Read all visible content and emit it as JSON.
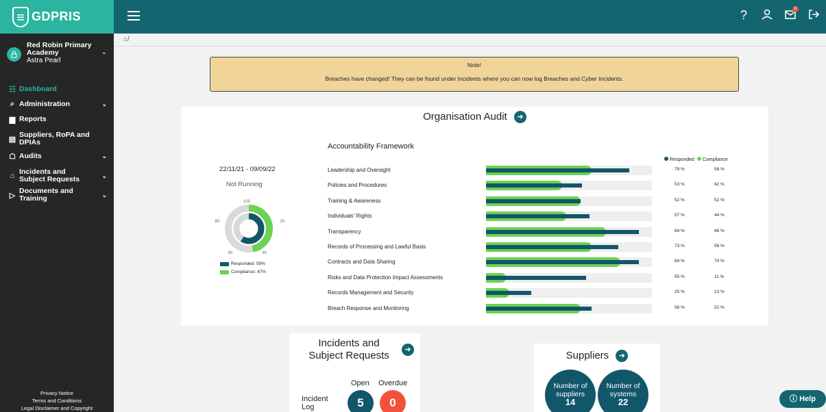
{
  "app": {
    "logo": "GDPRIS"
  },
  "profile": {
    "org": "Red Robin Primary Academy",
    "user": "Astra Pearl"
  },
  "sidebar": {
    "items": [
      {
        "label": "Dashboard",
        "icon": "grid-icon",
        "chevron": false,
        "active": true
      },
      {
        "label": "Administration",
        "icon": "key-icon",
        "chevron": true
      },
      {
        "label": "Reports",
        "icon": "bar-chart-icon",
        "chevron": false
      },
      {
        "label": "Suppliers, RoPA and DPIAs",
        "icon": "clipboard-icon",
        "chevron": false
      },
      {
        "label": "Audits",
        "icon": "audit-icon",
        "chevron": true
      },
      {
        "label": "Incidents and Subject Requests",
        "icon": "lock-icon",
        "chevron": true
      },
      {
        "label": "Documents and Training",
        "icon": "folder-icon",
        "chevron": true
      }
    ],
    "footer": [
      "Privacy Notice",
      "Terms and Conditions",
      "Legal Disclaimer and Copyright"
    ]
  },
  "topbar": {
    "notification_count": "6"
  },
  "breadcrumb": "/",
  "note": {
    "title": "Note!",
    "text": "Breaches have changed! They can be found under Incidents where you can now log Breaches and Cyber Incidents."
  },
  "audit": {
    "title": "Organisation Audit",
    "dates": "22/11/21 - 09/09/22",
    "status": "Not Running",
    "donut": {
      "ticks": [
        "100",
        "20",
        "40",
        "60",
        "80"
      ],
      "responded_label": "Responded: 59%",
      "compliance_label": "Compliance: 47%",
      "responded": 59,
      "compliance": 47
    },
    "framework_title": "Accountability Framework",
    "legend": {
      "responded": "Responded",
      "compliance": "Compliance"
    },
    "colors": {
      "responded": "#12566a",
      "compliance": "#6cd251"
    }
  },
  "chart_data": {
    "type": "bar",
    "categories": [
      "Leadership and Oversight",
      "Policies and Procedures",
      "Training & Awareness",
      "Individuals' Rights",
      "Transparency",
      "Records of Processing and Lawful Basis",
      "Contracts and Data Sharing",
      "Risks and Data Protection Impact Assessments",
      "Records Management and Security",
      "Breach Response and Monitoring"
    ],
    "series": [
      {
        "name": "Responded",
        "values": [
          79,
          53,
          52,
          57,
          84,
          73,
          84,
          55,
          25,
          58
        ],
        "labels": [
          "79 %",
          "53 %",
          "52 %",
          "57 %",
          "84 %",
          "73 %",
          "84 %",
          "55 %",
          "25 %",
          "58 %"
        ]
      },
      {
        "name": "Compliance",
        "values": [
          58,
          42,
          52,
          44,
          66,
          58,
          74,
          11,
          13,
          52
        ],
        "labels": [
          "58 %",
          "42 %",
          "52 %",
          "44 %",
          "66 %",
          "58 %",
          "74 %",
          "11 %",
          "13 %",
          "52 %"
        ]
      }
    ],
    "ylim": [
      0,
      100
    ]
  },
  "incidents": {
    "title": "Incidents and Subject Requests",
    "col_open": "Open",
    "col_overdue": "Overdue",
    "row_label": "Incident Log",
    "open": "5",
    "overdue": "0"
  },
  "suppliers": {
    "title": "Suppliers",
    "num_suppliers_label": "Number of suppliers",
    "num_suppliers": "14",
    "num_systems_label": "Number of systems",
    "num_systems": "22"
  },
  "help": {
    "label": "Help"
  }
}
